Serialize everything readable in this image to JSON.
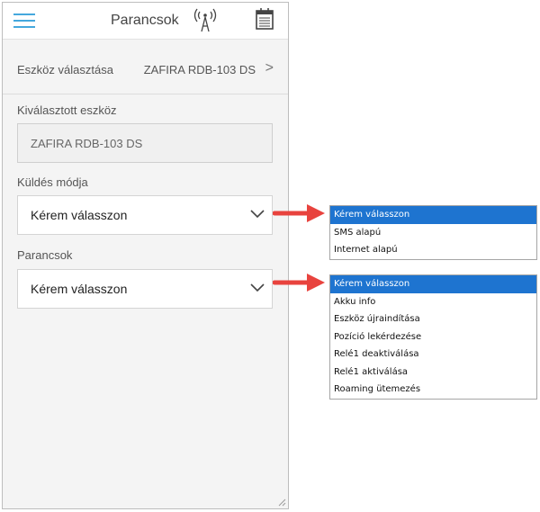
{
  "topbar": {
    "title": "Parancsok"
  },
  "device_select": {
    "label": "Eszköz választása",
    "value": "ZAFIRA RDB-103 DS",
    "chevron": ">"
  },
  "selected_device": {
    "label": "Kiválasztott eszköz",
    "value": "ZAFIRA RDB-103 DS"
  },
  "send_mode": {
    "label": "Küldés módja",
    "value": "Kérem válasszon",
    "options": [
      "Kérem válasszon",
      "SMS alapú",
      "Internet alapú"
    ]
  },
  "commands": {
    "label": "Parancsok",
    "value": "Kérem válasszon",
    "options": [
      "Kérem válasszon",
      "Akku info",
      "Eszköz újraindítása",
      "Pozíció lekérdezése",
      "Relé1 deaktiválása",
      "Relé1 aktiválása",
      "Roaming ütemezés"
    ]
  },
  "colors": {
    "accent": "#45a8dd",
    "arrow": "#e8433e",
    "selected_option": "#1e74d0"
  }
}
